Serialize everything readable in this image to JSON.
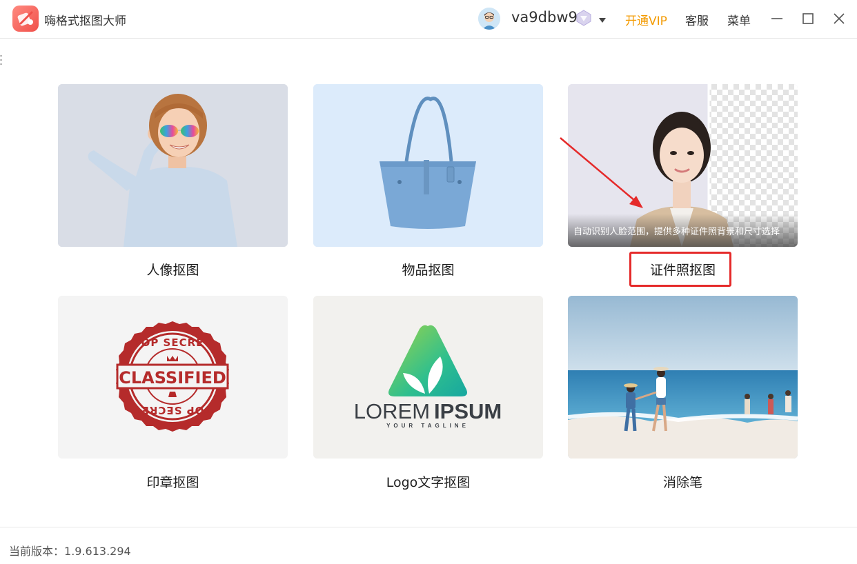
{
  "app": {
    "title": "嗨格式抠图大师"
  },
  "header": {
    "username": "va9dbw9",
    "vip_label": "开通VIP",
    "service_label": "客服",
    "menu_label": "菜单"
  },
  "cards": [
    {
      "label": "人像抠图",
      "image": "girl-with-sunglasses"
    },
    {
      "label": "物品抠图",
      "image": "blue-handbag"
    },
    {
      "label": "证件照抠图",
      "image": "id-photo-woman",
      "caption": "自动识别人脸范围，提供多种证件照背景和尺寸选择"
    },
    {
      "label": "印章抠图",
      "image": "classified-stamp",
      "stamp_top": "TOP SECRET",
      "stamp_center": "CLASSIFIED",
      "stamp_bottom": "TOP SECRET"
    },
    {
      "label": "Logo文字抠图",
      "image": "lorem-ipsum-logo",
      "logo_word1": "LOREM",
      "logo_word2": "IPSUM",
      "logo_tagline": "YOUR TAGLINE"
    },
    {
      "label": "消除笔",
      "image": "beach-scene"
    }
  ],
  "footer": {
    "version_label": "当前版本：",
    "version_value": "1.9.613.294"
  },
  "colors": {
    "vip": "#f39a00",
    "highlight": "#e52a2a",
    "brand": "#f0504a"
  }
}
